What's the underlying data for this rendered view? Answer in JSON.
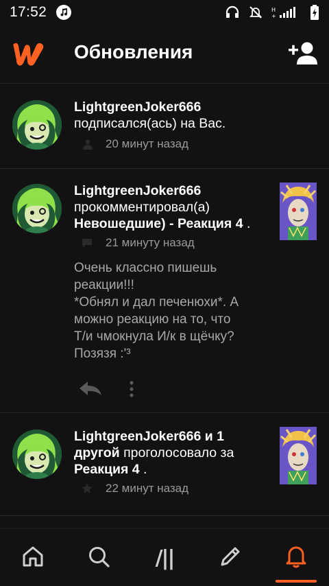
{
  "status_bar": {
    "time": "17:52",
    "icons": [
      "music-icon",
      "headphones-icon",
      "bell-muted-icon",
      "signal-icon",
      "battery-icon"
    ]
  },
  "header": {
    "title": "Обновления",
    "logo": "wattpad-logo",
    "action_icon": "add-user-icon"
  },
  "feed": {
    "items": [
      {
        "user": "LightgreenJoker666",
        "action": "подписался(ась) на Вас.",
        "time": "20 минут назад",
        "meta_icon": "person-icon"
      },
      {
        "user": "LightgreenJoker666",
        "action": "прокомментировал(а)",
        "target": "Невошедшие) - Реакция 4",
        "target_suffix": " .",
        "time": "21 минуту назад",
        "meta_icon": "comment-icon",
        "comment_lines": [
          "Очень классно пишешь",
          "реакции!!!",
          "*Обнял и дал печенюхи*. А",
          "можно реакцию на то, что",
          "Т/и чмокнула И/к в щёчку?",
          "Позязя :'³"
        ]
      },
      {
        "user": "LightgreenJoker666",
        "user_suffix": " и 1",
        "others": "другой",
        "action": " проголосовало за",
        "target": "Реакция 4",
        "target_suffix": " .",
        "time": "22 минут назад",
        "meta_icon": "star-icon"
      }
    ]
  },
  "bottom_nav": {
    "items": [
      "home-icon",
      "search-icon",
      "library-icon",
      "write-icon",
      "notifications-icon"
    ],
    "library_glyph": "/||",
    "active": "notifications-icon"
  },
  "colors": {
    "background": "#121212",
    "accent": "#ff6122",
    "muted_text": "#9a9a9a"
  }
}
